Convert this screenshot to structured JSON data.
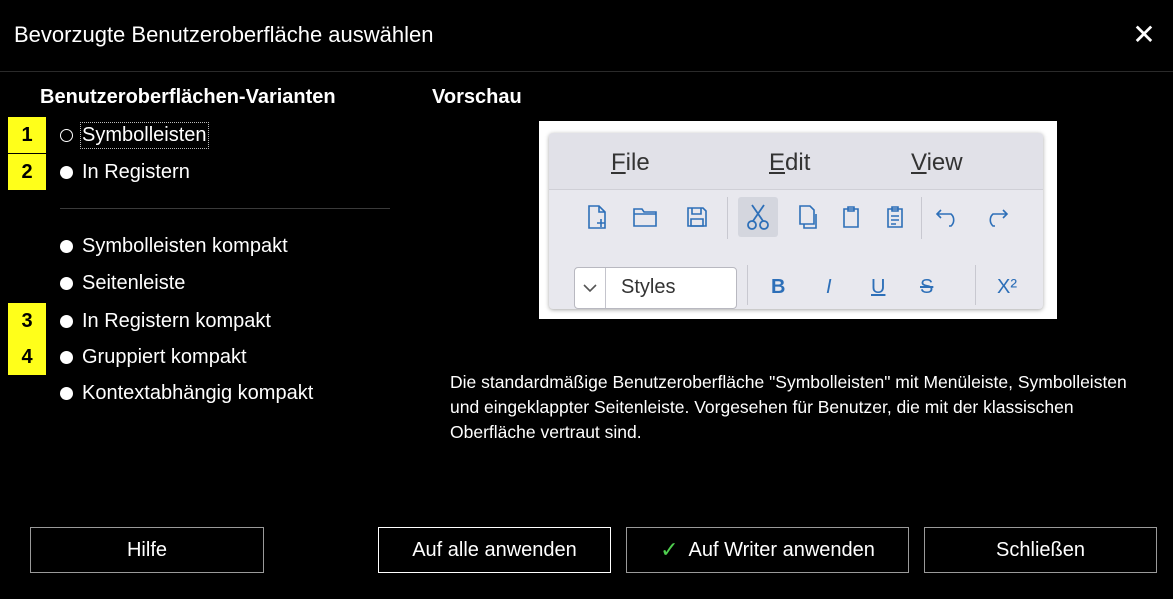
{
  "window": {
    "title": "Bevorzugte Benutzeroberfläche auswählen",
    "close_glyph": "✕"
  },
  "variants": {
    "heading": "Benutzeroberflächen-Varianten",
    "options": [
      {
        "label": "Symbolleisten",
        "selected": true,
        "badge": "1"
      },
      {
        "label": "In Registern",
        "selected": false,
        "badge": "2"
      },
      {
        "label": "Symbolleisten kompakt",
        "selected": false,
        "badge": ""
      },
      {
        "label": "Seitenleiste",
        "selected": false,
        "badge": ""
      },
      {
        "label": "In Registern kompakt",
        "selected": false,
        "badge": "3"
      },
      {
        "label": "Gruppiert kompakt",
        "selected": false,
        "badge": "4"
      },
      {
        "label": "Kontextabhängig kompakt",
        "selected": false,
        "badge": ""
      }
    ]
  },
  "preview": {
    "heading": "Vorschau",
    "menus": [
      {
        "accel": "F",
        "rest": "ile"
      },
      {
        "accel": "E",
        "rest": "dit"
      },
      {
        "accel": "V",
        "rest": "iew"
      }
    ],
    "styles_label": "Styles",
    "format_buttons": [
      "B",
      "I",
      "U",
      "S",
      "X²"
    ]
  },
  "description": "Die standardmäßige Benutzeroberfläche \"Symbolleisten\" mit Menüleiste, Symbolleisten und eingeklappter Seitenleiste. Vorgesehen für Benutzer, die mit der klassischen Oberfläche vertraut sind.",
  "buttons": {
    "help": "Hilfe",
    "apply_all": "Auf alle anwenden",
    "apply_writer": "Auf Writer anwenden",
    "close": "Schließen"
  },
  "colors": {
    "background": "#000000",
    "badge": "#ffff1a",
    "checkmark": "#4fcf4f",
    "preview_icon": "#2d6fb8"
  }
}
